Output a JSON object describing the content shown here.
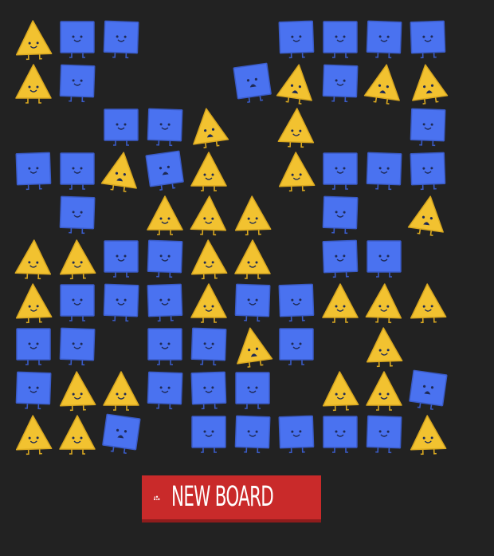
{
  "board": {
    "rows": 10,
    "cols": 10,
    "legend": {
      "T": "triangle",
      "S": "square",
      "O": "empty"
    },
    "cells": [
      [
        "T",
        "S",
        "S",
        "O",
        "O",
        "O",
        "S",
        "S",
        "S",
        "S"
      ],
      [
        "T",
        "S",
        "O",
        "O",
        "O",
        "S",
        "T",
        "S",
        "T",
        "T"
      ],
      [
        "O",
        "O",
        "S",
        "S",
        "T",
        "O",
        "T",
        "O",
        "O",
        "S"
      ],
      [
        "S",
        "S",
        "T",
        "S",
        "T",
        "O",
        "T",
        "S",
        "S",
        "S"
      ],
      [
        "O",
        "S",
        "O",
        "T",
        "T",
        "T",
        "O",
        "S",
        "O",
        "T"
      ],
      [
        "T",
        "T",
        "S",
        "S",
        "T",
        "T",
        "O",
        "S",
        "S",
        "O"
      ],
      [
        "T",
        "S",
        "S",
        "S",
        "T",
        "S",
        "S",
        "T",
        "T",
        "T"
      ],
      [
        "S",
        "S",
        "O",
        "S",
        "S",
        "T",
        "S",
        "O",
        "T",
        "O"
      ],
      [
        "S",
        "T",
        "T",
        "S",
        "S",
        "S",
        "O",
        "T",
        "T",
        "S"
      ],
      [
        "T",
        "T",
        "S",
        "O",
        "S",
        "S",
        "S",
        "S",
        "S",
        "T"
      ]
    ],
    "unhappy": [
      [
        1,
        5
      ],
      [
        1,
        6
      ],
      [
        1,
        8
      ],
      [
        1,
        9
      ],
      [
        2,
        4
      ],
      [
        3,
        2
      ],
      [
        3,
        3
      ],
      [
        4,
        9
      ],
      [
        7,
        5
      ],
      [
        8,
        9
      ],
      [
        9,
        2
      ]
    ]
  },
  "colors": {
    "background": "#222222",
    "square": "#4a72f0",
    "square_outline": "#3a5bc7",
    "triangle": "#f2c230",
    "triangle_outline": "#d9a820",
    "face": "#1e2a55",
    "button": "#c92a2a",
    "button_shadow": "#8f1c1c",
    "button_text": "#ffffff"
  },
  "new_board_button": {
    "label": "NEW BOARD",
    "icon": "shapes-icon"
  }
}
